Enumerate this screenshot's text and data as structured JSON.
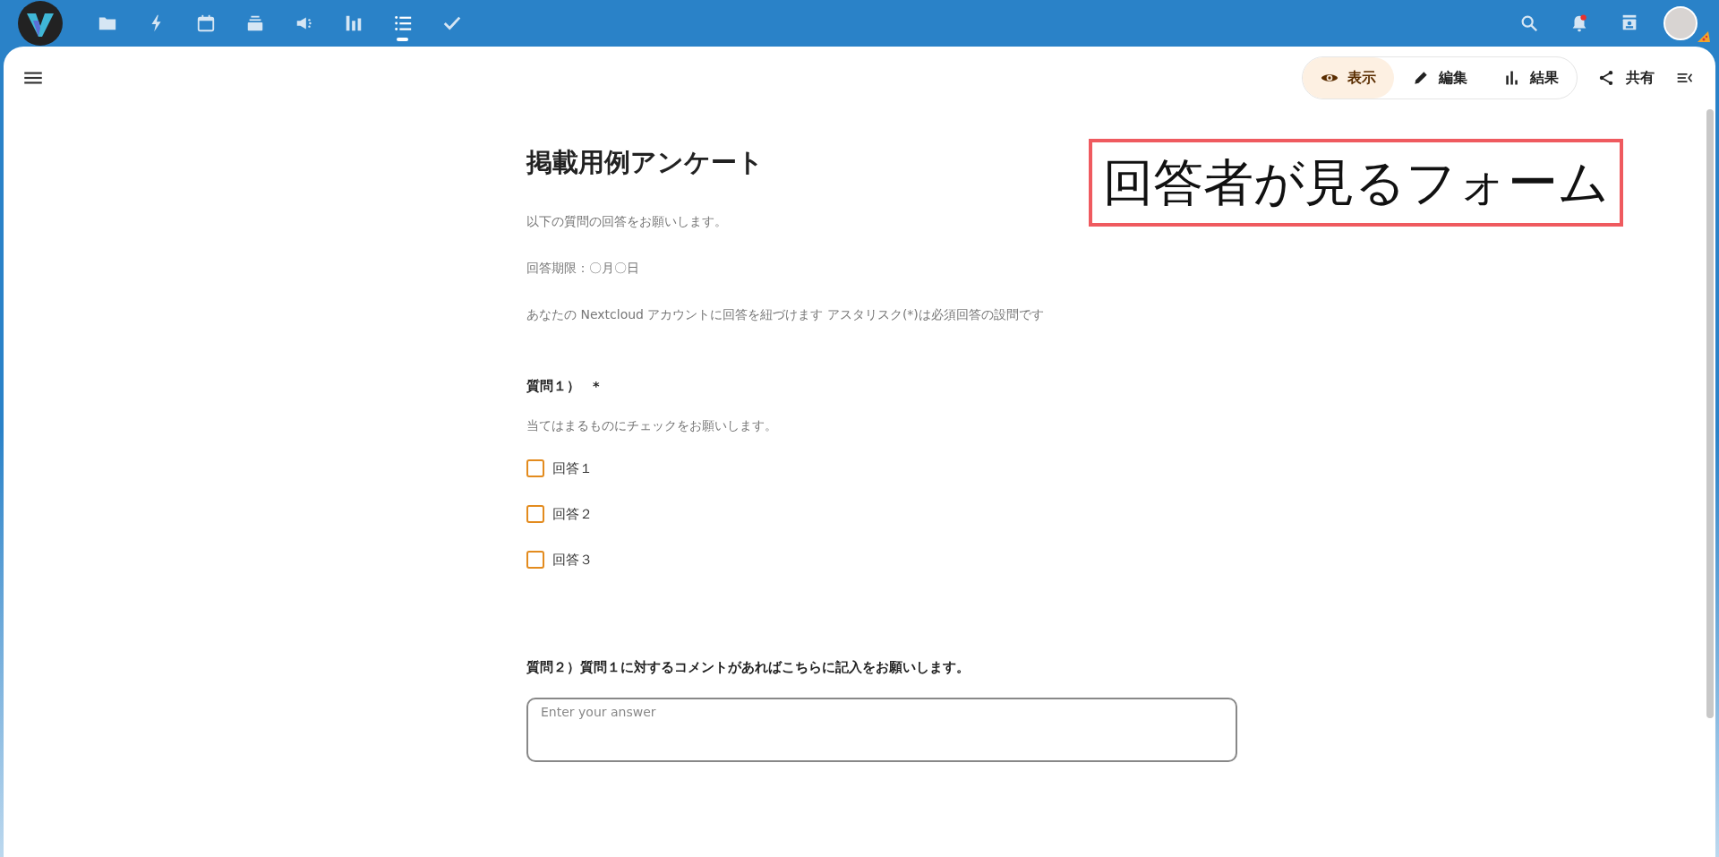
{
  "top_bar": {
    "apps": [
      {
        "kind": "files",
        "selected": false
      },
      {
        "kind": "activity",
        "selected": false
      },
      {
        "kind": "calendar",
        "selected": false
      },
      {
        "kind": "deck",
        "selected": false
      },
      {
        "kind": "announcements",
        "selected": false
      },
      {
        "kind": "analytics",
        "selected": false
      },
      {
        "kind": "forms",
        "selected": true
      },
      {
        "kind": "tasks",
        "selected": false
      }
    ],
    "notifications": {
      "unread": true
    }
  },
  "view_switcher": [
    {
      "kind": "view",
      "label": "表示",
      "selected": true
    },
    {
      "kind": "edit",
      "label": "編集",
      "selected": false
    },
    {
      "kind": "results",
      "label": "結果",
      "selected": false
    }
  ],
  "share": {
    "label": "共有"
  },
  "form": {
    "title": "掲載用例アンケート",
    "descriptions": [
      "以下の質問の回答をお願いします。",
      "回答期限：〇月〇日",
      "あなたの Nextcloud アカウントに回答を紐づけます アスタリスク(*)は必須回答の設問です"
    ],
    "questions": [
      {
        "kind": "checkbox",
        "title": "質問１）",
        "required_mark": "*",
        "hint": "当てはまるものにチェックをお願いします。",
        "options": [
          {
            "label": "回答１",
            "checked": false
          },
          {
            "label": "回答２",
            "checked": false
          },
          {
            "label": "回答３",
            "checked": false
          }
        ]
      },
      {
        "kind": "long_text",
        "title": "質問２）質問１に対するコメントがあればこちらに記入をお願いします。",
        "placeholder": "Enter your answer"
      }
    ]
  },
  "annotation": {
    "text": "回答者が見るフォーム"
  }
}
